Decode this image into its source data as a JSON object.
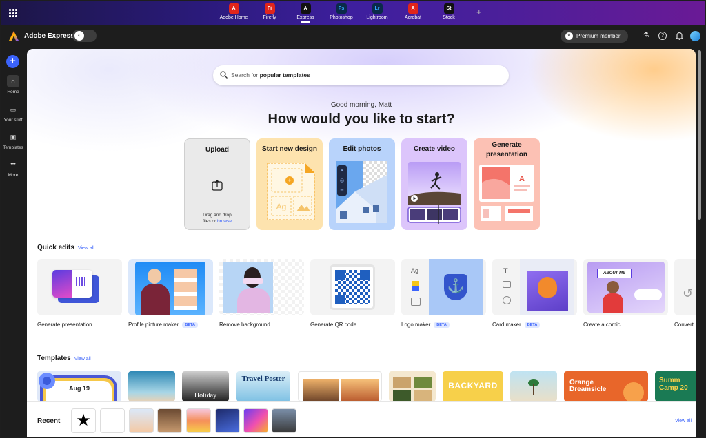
{
  "appbar": {
    "apps": [
      {
        "label": "Adobe Home",
        "code": "A",
        "color": "#e1251b",
        "active": false
      },
      {
        "label": "Firefly",
        "code": "Fi",
        "color": "#e1251b",
        "active": false
      },
      {
        "label": "Express",
        "code": "A",
        "color": "#111111",
        "active": true
      },
      {
        "label": "Photoshop",
        "code": "Ps",
        "color": "#0a2a4a",
        "active": false
      },
      {
        "label": "Lightroom",
        "code": "Lr",
        "color": "#0a2a4a",
        "active": false
      },
      {
        "label": "Acrobat",
        "code": "A",
        "color": "#e1251b",
        "active": false
      },
      {
        "label": "Stock",
        "code": "St",
        "color": "#111111",
        "active": false
      }
    ],
    "add_tab": "+"
  },
  "header": {
    "brand": "Adobe Express",
    "premium": "Premium member",
    "icons": [
      "beaker-icon",
      "help-icon",
      "bell-icon"
    ]
  },
  "rail": {
    "items": [
      {
        "label": "Home",
        "icon": "home-icon",
        "glyph": "⌂",
        "active": true
      },
      {
        "label": "Your stuff",
        "icon": "folder-icon",
        "glyph": "▭",
        "active": false
      },
      {
        "label": "Templates",
        "icon": "templates-icon",
        "glyph": "▣",
        "active": false
      },
      {
        "label": "More",
        "icon": "more-icon",
        "glyph": "•••",
        "active": false
      }
    ]
  },
  "hero": {
    "search_prefix": "Search for ",
    "search_bold": "popular templates",
    "greeting": "Good morning, Matt",
    "headline": "How would you like to start?"
  },
  "starts": {
    "upload": {
      "title": "Upload",
      "hint_line1": "Drag and drop",
      "hint_line2": "files or ",
      "browse": "browse"
    },
    "new_design": {
      "title": "Start new design"
    },
    "edit_photos": {
      "title": "Edit photos"
    },
    "create_video": {
      "title": "Create video"
    },
    "generate_presentation": {
      "title": "Generate presentation"
    }
  },
  "quick_edits": {
    "title": "Quick edits",
    "view_all": "View all",
    "items": [
      {
        "label": "Generate presentation",
        "beta": ""
      },
      {
        "label": "Profile picture maker",
        "beta": "BETA"
      },
      {
        "label": "Remove background",
        "beta": ""
      },
      {
        "label": "Generate QR code",
        "beta": ""
      },
      {
        "label": "Logo maker",
        "beta": "BETA"
      },
      {
        "label": "Card maker",
        "beta": "BETA"
      },
      {
        "label": "Create a comic",
        "beta": ""
      },
      {
        "label": "Convert",
        "beta": ""
      }
    ]
  },
  "templates": {
    "title": "Templates",
    "view_all": "View all",
    "items": [
      {
        "text": "Aug 19"
      },
      {
        "text": ""
      },
      {
        "text": "Holiday"
      },
      {
        "text": "Travel Poster"
      },
      {
        "text": ""
      },
      {
        "text": ""
      },
      {
        "text": "BACKYARD"
      },
      {
        "text": ""
      },
      {
        "text": "Orange Dreamsicle"
      },
      {
        "text": "Summ Camp 20"
      }
    ]
  },
  "recent": {
    "title": "Recent",
    "view_all": "View all"
  }
}
